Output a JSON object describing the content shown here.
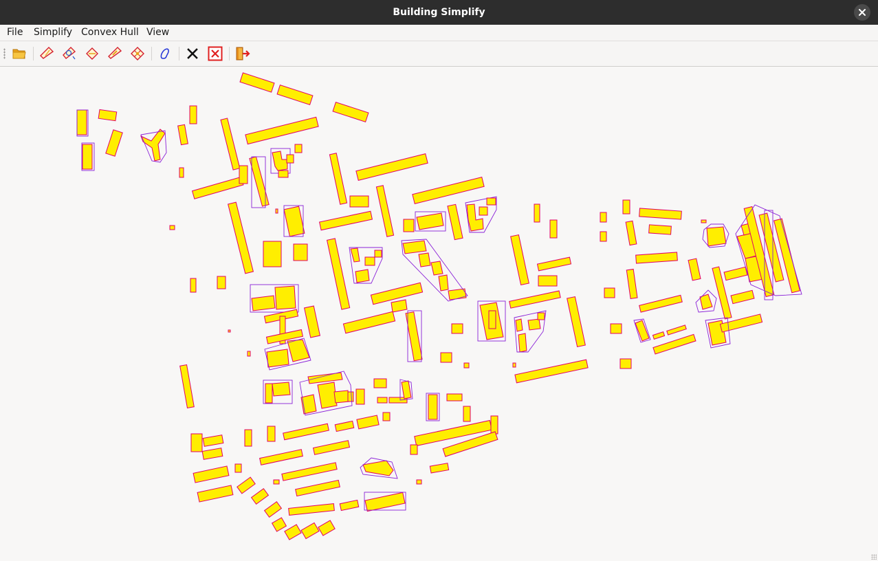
{
  "window": {
    "title": "Building Simplify",
    "close_icon": "close-icon"
  },
  "menubar": {
    "items": [
      "File",
      "Simplify",
      "Convex Hull",
      "View"
    ]
  },
  "toolbar": {
    "buttons": [
      {
        "name": "open-folder",
        "icon": "folder-open-icon"
      },
      {
        "name": "simplify-1",
        "icon": "simplify-rectangle-icon"
      },
      {
        "name": "simplify-2",
        "icon": "simplify-rotate-icon"
      },
      {
        "name": "simplify-3",
        "icon": "simplify-diamond-icon"
      },
      {
        "name": "simplify-4",
        "icon": "simplify-edge-icon"
      },
      {
        "name": "simplify-5",
        "icon": "simplify-grid-icon"
      },
      {
        "name": "convex-hull",
        "icon": "convex-hull-icon"
      },
      {
        "name": "clear",
        "icon": "clear-icon"
      },
      {
        "name": "clear-all",
        "icon": "clear-all-icon"
      },
      {
        "name": "exit",
        "icon": "exit-icon"
      }
    ]
  },
  "colors": {
    "building_fill": "#ffee00",
    "building_outline": "#e0006a",
    "hull_outline": "#8a20d8"
  }
}
